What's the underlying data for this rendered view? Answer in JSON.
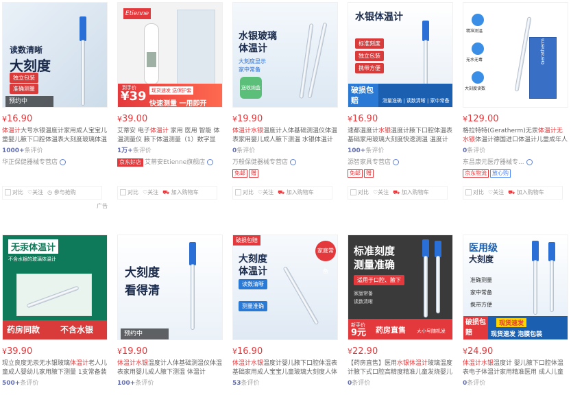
{
  "products": [
    {
      "price": "16.90",
      "title_pre": "",
      "title_hl": "体温计",
      "title_rest": "大号水银温度计家用成人宝宝儿童婴儿腋下口腔体温表大刻度玻璃体温表快",
      "commit_count": "1000+",
      "commit_suffix": "条评价",
      "shop": "华正保健器械专营店",
      "tags": [],
      "ops": [
        "对比",
        "关注",
        "参与抢购"
      ],
      "ad": "广告",
      "badge": "预约中",
      "img_texts": [
        "读数清晰",
        "大刻度",
        "独立包装",
        "准确测量",
        "远离高温"
      ]
    },
    {
      "price": "39.00",
      "title_pre": "艾蒂安 电子",
      "title_hl": "体温计",
      "title_rest": " 家用 医用 智能 体温测量仪 腋下体温测量（1）数字显示，读",
      "commit_count": "1万+",
      "commit_suffix": "条评价",
      "shop": "艾蒂安Etienne旗舰店",
      "tags": [
        "京东好店"
      ],
      "ops": [
        "对比",
        "关注",
        "加入购物车"
      ],
      "badge": "",
      "img_texts": [
        "Etienne",
        "到手价",
        "¥39",
        "现货速发 送保护套",
        "快速测量 一用即开"
      ]
    },
    {
      "price": "19.90",
      "title_pre": "",
      "title_hl": "体温计水银",
      "title_rest": "温度计人体基础测温仪体温表家用婴儿成人腋下测温 水银体温计 体温",
      "commit_count": "0",
      "commit_suffix": "条评价",
      "shop": "万般保健器械专营店",
      "tags": [
        "免邮",
        "赠"
      ],
      "ops": [
        "对比",
        "关注",
        "加入购物车"
      ],
      "badge": "",
      "img_texts": [
        "水银玻璃",
        "体温计",
        "大刻度显示",
        "家中常备",
        "送收纳盒"
      ]
    },
    {
      "price": "16.90",
      "title_pre": "速都温度计",
      "title_hl": "水银",
      "title_rest": "温度计腋下口腔体温表基础家用玻璃大刻度快速测温 温度计【35-",
      "commit_count": "100+",
      "commit_suffix": "条评价",
      "shop": "源智家具专营店",
      "tags": [
        "免邮",
        "赠"
      ],
      "ops": [
        "对比",
        "关注",
        "加入购物车"
      ],
      "badge": "",
      "img_texts": [
        "水银体温计",
        "标准刻度",
        "独立包装",
        "携带方便",
        "破损包赔",
        "测量准确 | 读数清晰 | 家中常备"
      ]
    },
    {
      "price": "129.00",
      "title_pre": "格拉特特(Geratherm)无汞",
      "title_hl": "体温计无水银",
      "title_rest": "体温计德国进口体温计儿童成年人家",
      "commit_count": "0",
      "commit_suffix": "条评价",
      "shop": "东昌康元医疗器械专...",
      "tags": [
        "京东物流",
        "放心购"
      ],
      "ops": [
        "对比",
        "关注",
        "加入购物车"
      ],
      "badge": "",
      "img_texts": [
        "精准测温",
        "无水无毒",
        "大刻度读数",
        "Geratherm"
      ]
    },
    {
      "price": "39.90",
      "title_pre": "现立良度无汞无水银玻璃",
      "title_hl": "体温计",
      "title_rest": "老人儿童成人婴幼儿家用腋下测量 1支常备装 每天",
      "commit_count": "500+",
      "commit_suffix": "条评价",
      "shop": "",
      "tags": [],
      "ops": [],
      "badge": "",
      "img_texts": [
        "无汞体温计",
        "不含水银的玻璃体温计",
        "药房同款",
        "不含水银"
      ]
    },
    {
      "price": "19.90",
      "title_pre": "",
      "title_hl": "体温计水银",
      "title_rest": "温度计人体基础测温仪体温表家用婴儿成人腋下测温 体温计",
      "commit_count": "100+",
      "commit_suffix": "条评价",
      "shop": "",
      "tags": [],
      "ops": [],
      "badge": "预约中",
      "img_texts": [
        "大刻度",
        "看得清"
      ]
    },
    {
      "price": "16.90",
      "title_pre": "",
      "title_hl": "体温计水银",
      "title_rest": "温度计婴儿腋下口腔体温表基础家用成人宝宝儿童玻璃大刻度人体温度",
      "commit_count": "53",
      "commit_suffix": "条评价",
      "shop": "",
      "tags": [],
      "ops": [],
      "badge": "破损包赔",
      "img_texts": [
        "大刻度",
        "体温计",
        "读数清晰",
        "测量准确",
        "家庭常备"
      ]
    },
    {
      "price": "22.90",
      "title_pre": "【药房直售】医用",
      "title_hl": "水银体温计",
      "title_rest": "玻璃温度计腋下式口腔高精度精准儿童发烧婴儿大家",
      "commit_count": "0",
      "commit_suffix": "条评价",
      "shop": "",
      "tags": [],
      "ops": [],
      "badge": "",
      "img_texts": [
        "标准刻度",
        "测量准确",
        "适用于口腔、腋下",
        "家庭常备",
        "读数清晰",
        "新手价",
        "9元",
        "药房直售",
        "大小号随机发"
      ]
    },
    {
      "price": "24.90",
      "title_pre": "",
      "title_hl": "体温计水银",
      "title_rest": "温度计 婴儿腋下口腔体温表电子体温计家用精准医用 成人儿童体温枪",
      "commit_count": "0",
      "commit_suffix": "条评价",
      "shop": "",
      "tags": [],
      "ops": [],
      "badge": "",
      "img_texts": [
        "医用级",
        "大刻度",
        "准确测量",
        "家中常备",
        "携带方便",
        "破损包赔",
        "现货速发",
        "现货速发 泡膜包装"
      ]
    }
  ]
}
